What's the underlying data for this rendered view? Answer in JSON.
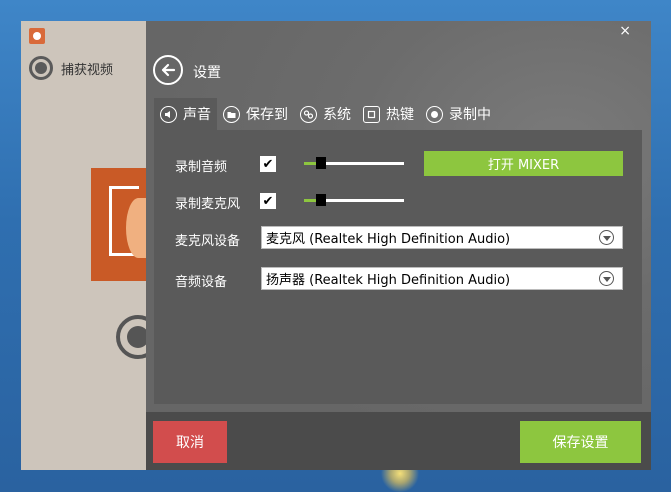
{
  "window": {
    "close_label": "×"
  },
  "left": {
    "capture_label": "捕获视频"
  },
  "header": {
    "title": "设置"
  },
  "tabs": [
    {
      "label": "声音",
      "icon": "speaker-icon",
      "active": true
    },
    {
      "label": "保存到",
      "icon": "folder-icon",
      "active": false
    },
    {
      "label": "系统",
      "icon": "gears-icon",
      "active": false
    },
    {
      "label": "热键",
      "icon": "hotkey-icon",
      "active": false
    },
    {
      "label": "录制中",
      "icon": "record-icon",
      "active": false
    }
  ],
  "sound": {
    "record_audio_label": "录制音频",
    "record_audio_checked": true,
    "record_audio_level": 0.12,
    "record_mic_label": "录制麦克风",
    "record_mic_checked": true,
    "record_mic_level": 0.12,
    "mixer_button": "打开 MIXER",
    "mic_device_label": "麦克风设备",
    "mic_device_value": "麦克风 (Realtek High Definition Audio)",
    "audio_device_label": "音频设备",
    "audio_device_value": "扬声器 (Realtek High Definition Audio)"
  },
  "footer": {
    "cancel_label": "取消",
    "save_label": "保存设置"
  },
  "colors": {
    "accent_green": "#8dc63f",
    "cancel_red": "#d24d4d",
    "panel_dark": "#5a5a5a"
  }
}
